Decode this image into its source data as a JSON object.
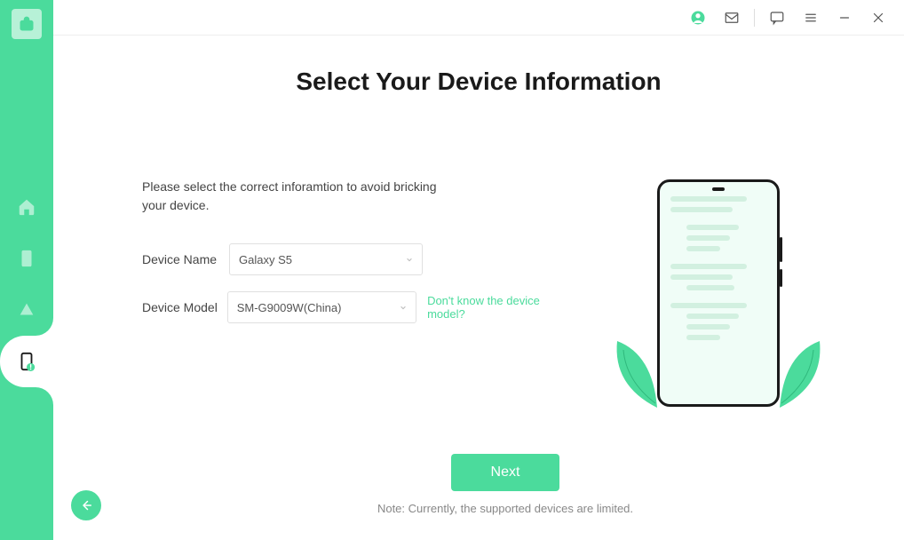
{
  "titlebar": {
    "icons": {
      "user": "user-icon",
      "mail": "mail-icon",
      "chat": "chat-icon",
      "menu": "menu-icon",
      "minimize": "minimize-icon",
      "close": "close-icon"
    }
  },
  "sidebar": {
    "items": [
      {
        "name": "home",
        "active": false
      },
      {
        "name": "phone",
        "active": false
      },
      {
        "name": "cloud",
        "active": false
      },
      {
        "name": "device-alert",
        "active": true
      }
    ]
  },
  "page": {
    "title": "Select Your Device Information",
    "instruction": "Please select the correct inforamtion to avoid bricking your device."
  },
  "fields": {
    "device_name": {
      "label": "Device Name",
      "value": "Galaxy S5"
    },
    "device_model": {
      "label": "Device Model",
      "value": "SM-G9009W(China)",
      "help_link": "Don't know the device model?"
    }
  },
  "footer": {
    "next_label": "Next",
    "note": "Note: Currently, the supported devices are limited."
  },
  "colors": {
    "accent": "#4bdb9c"
  }
}
